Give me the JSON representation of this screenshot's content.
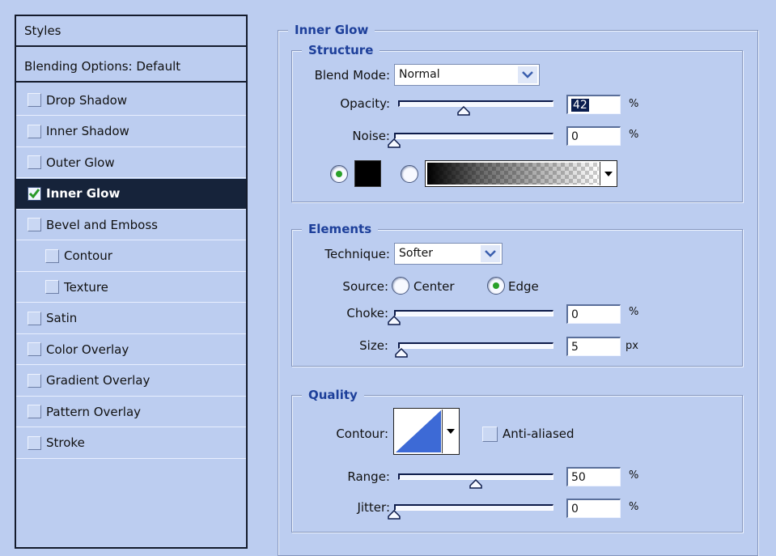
{
  "styles_list": {
    "header": "Styles",
    "blending_options": "Blending Options: Default",
    "items": [
      {
        "label": "Drop Shadow",
        "checked": false,
        "indent": false,
        "selected": false
      },
      {
        "label": "Inner Shadow",
        "checked": false,
        "indent": false,
        "selected": false
      },
      {
        "label": "Outer Glow",
        "checked": false,
        "indent": false,
        "selected": false
      },
      {
        "label": "Inner Glow",
        "checked": true,
        "indent": false,
        "selected": true
      },
      {
        "label": "Bevel and Emboss",
        "checked": false,
        "indent": false,
        "selected": false
      },
      {
        "label": "Contour",
        "checked": false,
        "indent": true,
        "selected": false
      },
      {
        "label": "Texture",
        "checked": false,
        "indent": true,
        "selected": false
      },
      {
        "label": "Satin",
        "checked": false,
        "indent": false,
        "selected": false
      },
      {
        "label": "Color Overlay",
        "checked": false,
        "indent": false,
        "selected": false
      },
      {
        "label": "Gradient Overlay",
        "checked": false,
        "indent": false,
        "selected": false
      },
      {
        "label": "Pattern Overlay",
        "checked": false,
        "indent": false,
        "selected": false
      },
      {
        "label": "Stroke",
        "checked": false,
        "indent": false,
        "selected": false
      }
    ]
  },
  "panel": {
    "title": "Inner Glow",
    "structure": {
      "title": "Structure",
      "blend_mode_label": "Blend Mode:",
      "blend_mode_value": "Normal",
      "opacity_label": "Opacity:",
      "opacity_value": "42",
      "opacity_unit": "%",
      "opacity_level": 0.42,
      "noise_label": "Noise:",
      "noise_value": "0",
      "noise_unit": "%",
      "noise_level": 0,
      "glow_color": "#000000"
    },
    "elements": {
      "title": "Elements",
      "technique_label": "Technique:",
      "technique_value": "Softer",
      "source_label": "Source:",
      "source_center": "Center",
      "source_edge": "Edge",
      "choke_label": "Choke:",
      "choke_value": "0",
      "choke_unit": "%",
      "choke_level": 0,
      "size_label": "Size:",
      "size_value": "5",
      "size_unit": "px",
      "size_level": 0.02
    },
    "quality": {
      "title": "Quality",
      "contour_label": "Contour:",
      "anti_aliased_label": "Anti-aliased",
      "range_label": "Range:",
      "range_value": "50",
      "range_unit": "%",
      "range_level": 0.5,
      "jitter_label": "Jitter:",
      "jitter_value": "0",
      "jitter_unit": "%",
      "jitter_level": 0
    }
  },
  "colors": {
    "background": "#bccdf0",
    "selected_row": "#16233a",
    "section_title": "#1d3f9a",
    "contour_blue": "#3d6ad6"
  }
}
